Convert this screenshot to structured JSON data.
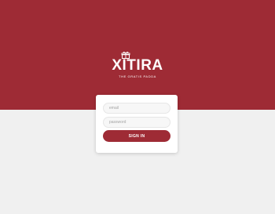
{
  "brand": {
    "name": "XITIRA",
    "tagline": "THE GRATIS PADDA",
    "primary_color": "#9e2b35",
    "icon": "gift-icon"
  },
  "login": {
    "email_placeholder": "email",
    "email_value": "",
    "password_placeholder": "password",
    "password_value": "",
    "submit_label": "SIGN IN"
  }
}
